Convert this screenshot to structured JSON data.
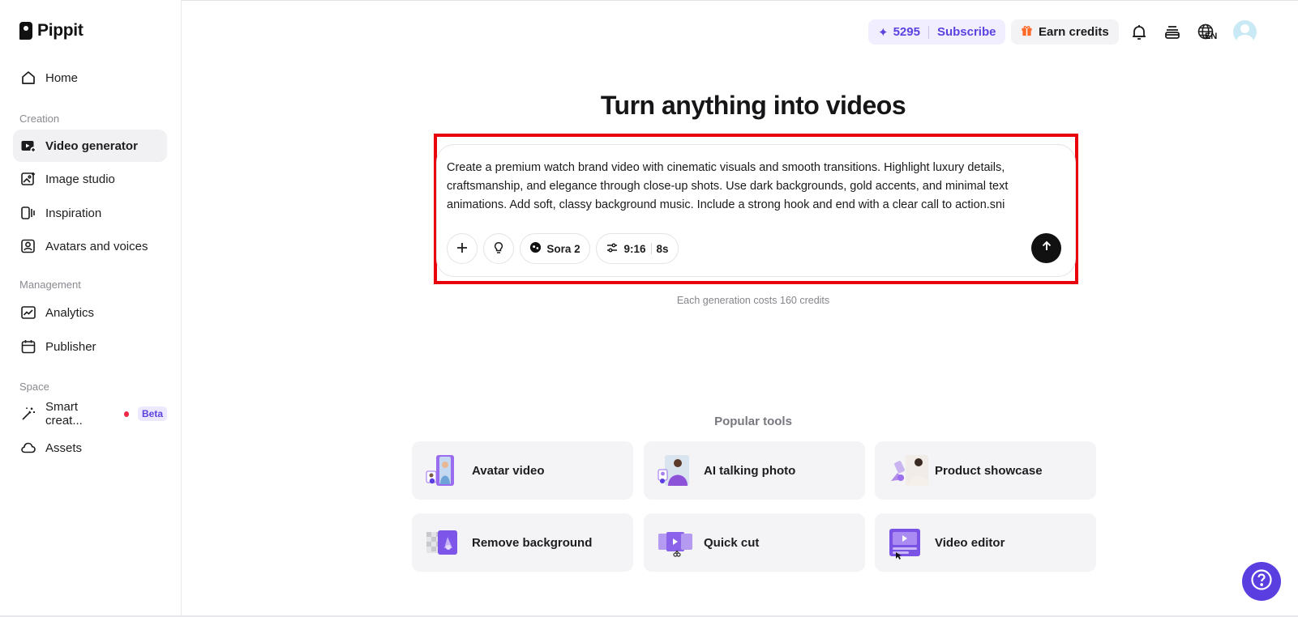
{
  "app": {
    "name": "Pippit"
  },
  "sidebar": {
    "home": "Home",
    "sections": {
      "creation": "Creation",
      "management": "Management",
      "space": "Space"
    },
    "creation_items": [
      {
        "label": "Video generator",
        "icon": "video-plus-icon",
        "active": true
      },
      {
        "label": "Image studio",
        "icon": "image-plus-icon"
      },
      {
        "label": "Inspiration",
        "icon": "inspiration-icon"
      },
      {
        "label": "Avatars and voices",
        "icon": "avatar-icon"
      }
    ],
    "management_items": [
      {
        "label": "Analytics",
        "icon": "analytics-icon"
      },
      {
        "label": "Publisher",
        "icon": "calendar-icon"
      }
    ],
    "space_items": [
      {
        "label": "Smart creat...",
        "icon": "magic-wand-icon",
        "badge": "Beta"
      },
      {
        "label": "Assets",
        "icon": "cloud-icon"
      }
    ]
  },
  "header": {
    "credits": "5295",
    "subscribe": "Subscribe",
    "earn_credits": "Earn credits",
    "language": "EN"
  },
  "main": {
    "headline": "Turn anything into videos",
    "prompt": "Create a premium watch brand video with cinematic visuals and smooth transitions. Highlight luxury details, craftsmanship, and elegance through close-up shots. Use dark backgrounds, gold accents, and minimal text animations. Add soft, classy background music. Include a strong hook and end with a clear call to action.sni",
    "model": "Sora 2",
    "ratio": "9:16",
    "duration": "8s",
    "cost_note": "Each generation costs 160 credits",
    "popular_title": "Popular tools",
    "tools": [
      {
        "label": "Avatar video"
      },
      {
        "label": "AI talking photo"
      },
      {
        "label": "Product showcase"
      },
      {
        "label": "Remove background"
      },
      {
        "label": "Quick cut"
      },
      {
        "label": "Video editor"
      }
    ]
  },
  "colors": {
    "accent": "#5b43e0",
    "highlight_border": "#e8000b",
    "help_button": "#5a3ee0"
  }
}
